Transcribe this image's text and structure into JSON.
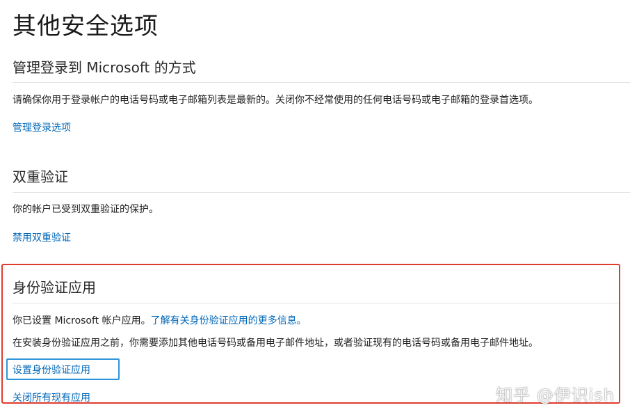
{
  "page": {
    "title": "其他安全选项"
  },
  "sections": {
    "signin": {
      "heading": "管理登录到 Microsoft 的方式",
      "description": "请确保你用于登录帐户的电话号码或电子邮箱列表是最新的。关闭你不经常使用的任何电话号码或电子邮箱的登录首选项。",
      "link": "管理登录选项"
    },
    "two_step": {
      "heading": "双重验证",
      "description": "你的帐户已受到双重验证的保护。",
      "link": "禁用双重验证"
    },
    "authenticator": {
      "heading": "身份验证应用",
      "description_prefix": "你已设置 Microsoft 帐户应用。",
      "learn_more_link": "了解有关身份验证应用的更多信息。",
      "note": "在安装身份验证应用之前，你需要添加其他电话号码或备用电子邮件地址，或者验证现有的电话号码或备用电子邮件地址。",
      "setup_link": "设置身份验证应用",
      "close_link": "关闭所有现有应用"
    }
  },
  "watermark": "知乎 @伊识ish",
  "colors": {
    "link": "#0067b8",
    "highlight_border": "#e03b2f",
    "focus_border": "#2f95d8"
  }
}
